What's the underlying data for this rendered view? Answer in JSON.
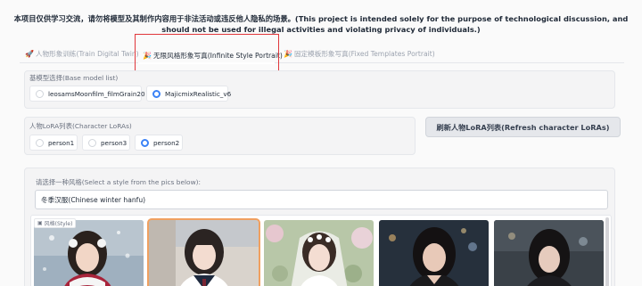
{
  "notice": "本项目仅供学习交流，请勿将模型及其制作内容用于非法活动或违反他人隐私的场景。(This project is intended solely for the purpose of technological discussion, and should not be used for illegal activities and violating privacy of individuals.)",
  "tabs": [
    {
      "label": "人物形象训练(Train Digital Twin)",
      "icon": "rocket-icon",
      "active": false
    },
    {
      "label": "无限风格形象写真(Infinite Style Portrait)",
      "icon": "party-popper-icon",
      "active": true
    },
    {
      "label": "固定模板形象写真(Fixed Templates Portrait)",
      "icon": "party-popper-icon",
      "active": false
    }
  ],
  "base_model": {
    "label": "基模型选择(Base model list)",
    "options": [
      {
        "label": "leosamsMoonfilm_filmGrain20",
        "selected": false
      },
      {
        "label": "MajicmixRealistic_v6",
        "selected": true
      }
    ]
  },
  "lora": {
    "label": "人物LoRA列表(Character LoRAs)",
    "options": [
      {
        "label": "person1",
        "selected": false
      },
      {
        "label": "person3",
        "selected": false
      },
      {
        "label": "person2",
        "selected": true
      }
    ]
  },
  "refresh_button": "刷新人物LoRA列表(Refresh character LoRAs)",
  "style": {
    "label": "请选择一种风格(Select a style from the pics below):",
    "value": "冬季汉服(Chinese winter hanfu)",
    "gallery_label": "风格(Style)",
    "thumbnails": [
      {
        "desc": "winter-hanfu",
        "selected": false
      },
      {
        "desc": "school-uniform",
        "selected": true
      },
      {
        "desc": "wedding-veil",
        "selected": false
      },
      {
        "desc": "night-city",
        "selected": false
      },
      {
        "desc": "rain-street",
        "selected": false
      }
    ]
  },
  "colors": {
    "accent": "#3b82f6",
    "highlight_box": "#e0363a",
    "selected_thumb": "#f0a060"
  }
}
